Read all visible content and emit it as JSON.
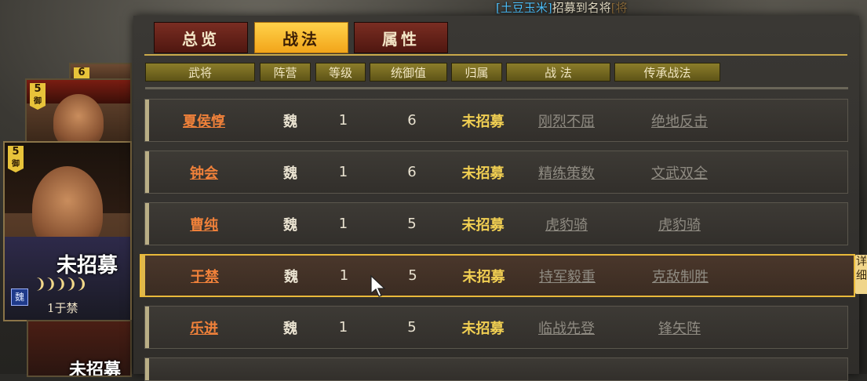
{
  "notice": {
    "name": "[土豆玉米]",
    "text": "招募到名将",
    "tail": "[将"
  },
  "tabs": [
    {
      "label": "总览",
      "active": false
    },
    {
      "label": "战法",
      "active": true
    },
    {
      "label": "属性",
      "active": false
    }
  ],
  "columns": [
    "武将",
    "阵营",
    "等级",
    "统御值",
    "归属",
    "战 法",
    "传承战法"
  ],
  "rows": [
    {
      "name": "夏侯惇",
      "faction": "魏",
      "level": "1",
      "command": "6",
      "owner": "未招募",
      "skill": "刚烈不屈",
      "inherit": "绝地反击"
    },
    {
      "name": "钟会",
      "faction": "魏",
      "level": "1",
      "command": "6",
      "owner": "未招募",
      "skill": "精练策数",
      "inherit": "文武双全"
    },
    {
      "name": "曹纯",
      "faction": "魏",
      "level": "1",
      "command": "5",
      "owner": "未招募",
      "skill": "虎豹骑",
      "inherit": "虎豹骑"
    },
    {
      "name": "于禁",
      "faction": "魏",
      "level": "1",
      "command": "5",
      "owner": "未招募",
      "skill": "持军毅重",
      "inherit": "克敌制胜",
      "selected": true
    },
    {
      "name": "乐进",
      "faction": "魏",
      "level": "1",
      "command": "5",
      "owner": "未招募",
      "skill": "临战先登",
      "inherit": "锋矢阵"
    }
  ],
  "side_tag": "详细",
  "cards": {
    "top_small": {
      "cost": "6"
    },
    "second": {
      "cost": "5",
      "type": "御"
    },
    "main": {
      "cost": "5",
      "type": "御",
      "status": "未招募",
      "stars": "❩❩❩❩❩",
      "faction": "魏",
      "label": "1于禁"
    },
    "bottom": {
      "status": "未招募"
    }
  }
}
